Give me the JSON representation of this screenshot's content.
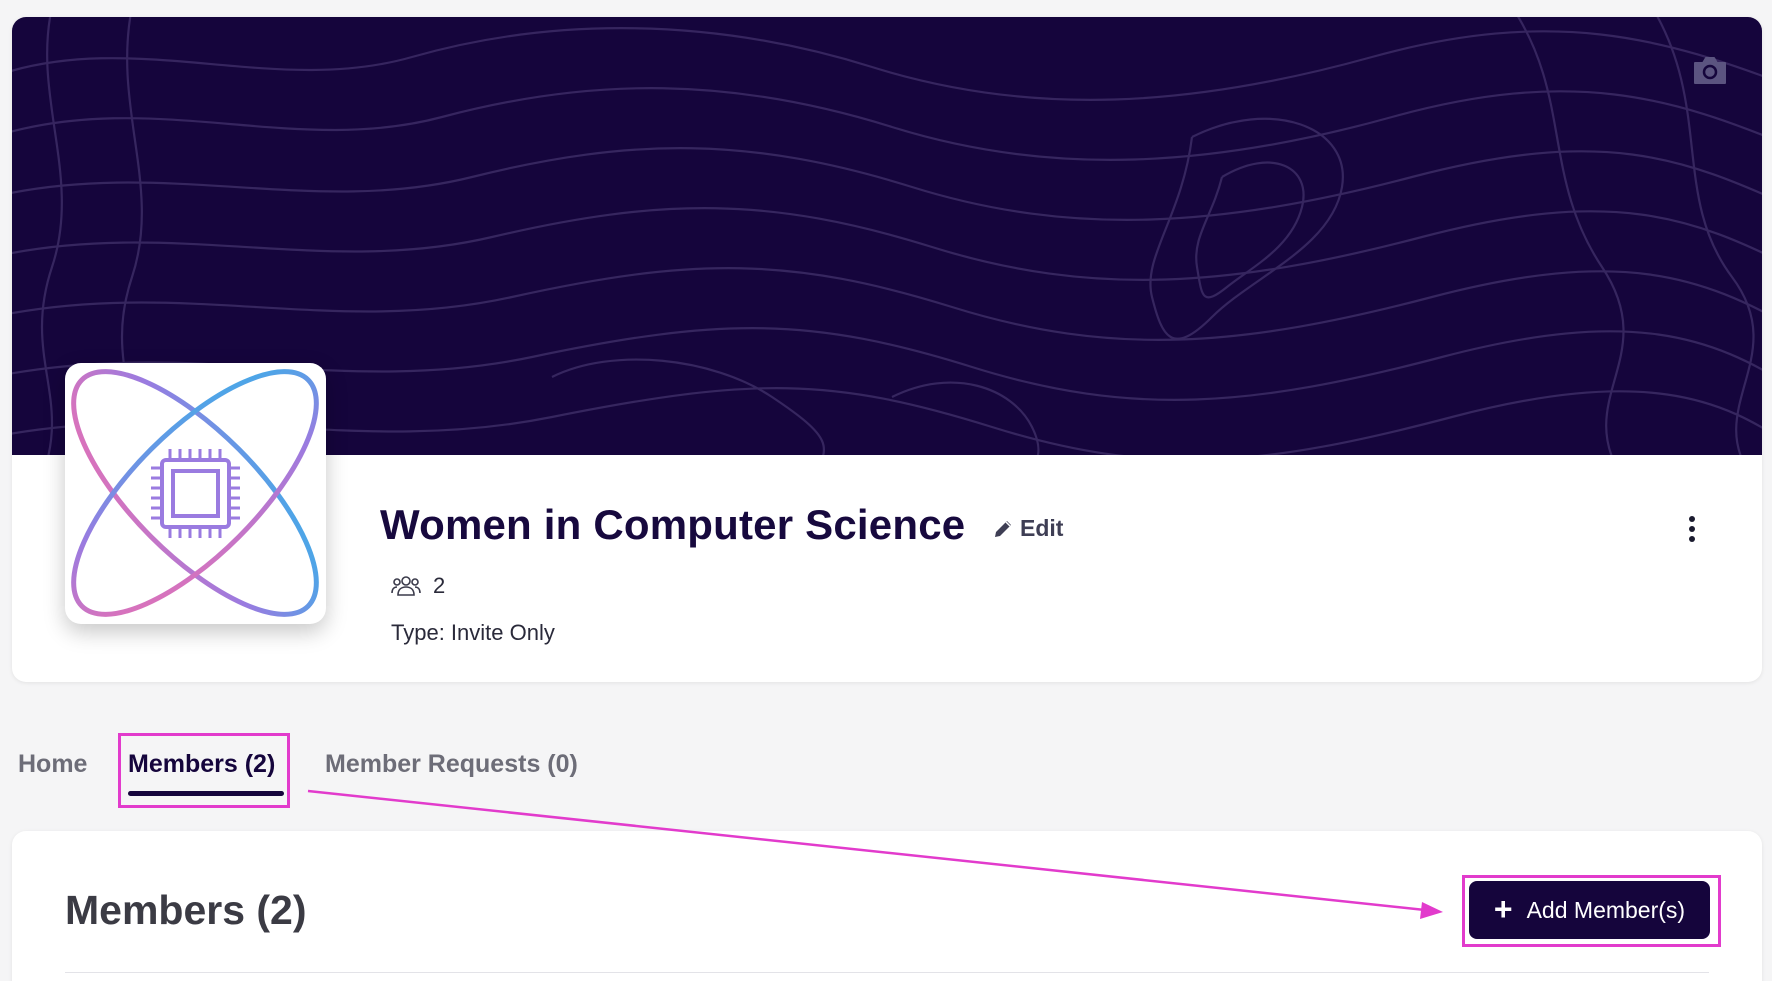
{
  "group": {
    "title": "Women in Computer Science",
    "edit_label": "Edit",
    "member_count": "2",
    "type_text": "Type: Invite Only",
    "logo_name": "atom-chip-logo"
  },
  "tabs": [
    {
      "label": "Home",
      "active": false
    },
    {
      "label": "Members (2)",
      "active": true
    },
    {
      "label": "Member Requests (0)",
      "active": false
    }
  ],
  "members_section": {
    "heading": "Members (2)",
    "add_button_label": "Add Member(s)"
  },
  "icons": {
    "cover_camera": "camera-icon",
    "edit": "pencil-icon",
    "members": "people-icon",
    "more": "more-vertical-icon",
    "add": "plus-icon"
  },
  "colors": {
    "brand_dark": "#15053c",
    "annotation": "#e23bcc",
    "logo_pink": "#f06fae",
    "logo_blue": "#2fb6ea",
    "logo_purple": "#9a7be0"
  }
}
